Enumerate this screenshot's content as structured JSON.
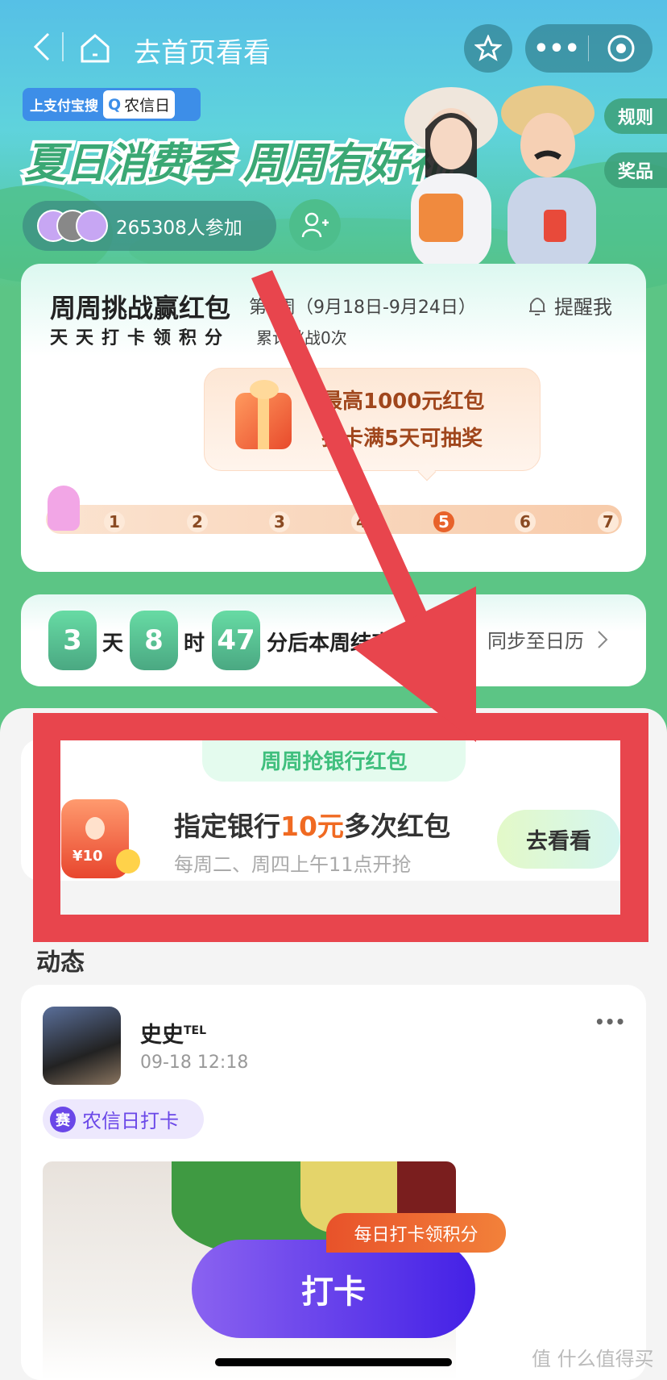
{
  "nav": {
    "title": "去首页看看",
    "back_icon": "chevron-left-icon",
    "home_icon": "home-icon",
    "star_icon": "star-icon",
    "more_icon": "more-dots-icon",
    "close_icon": "target-circle-icon"
  },
  "banner": {
    "search_prefix": "上支付宝搜",
    "search_keyword": "农信日",
    "headline": "夏日消费季 周周有好礼",
    "participants": "265308人参加",
    "rules_tab": "规则",
    "prizes_tab": "奖品"
  },
  "challenge": {
    "title": "周周挑战赢红包",
    "week": "第4周（9月18日-9月24日）",
    "remind": "提醒我",
    "subtitle": "天天打卡领积分",
    "count": "累计挑战0次",
    "bubble_line1": "最高1000元红包",
    "bubble_line2": "打卡满5天可抽奖",
    "days": [
      "1",
      "2",
      "3",
      "4",
      "5",
      "6",
      "7"
    ],
    "highlight_day": "5"
  },
  "countdown": {
    "days": "3",
    "days_unit": "天",
    "hours": "8",
    "hours_unit": "时",
    "minutes": "47",
    "suffix": "分后本周结束",
    "sync": "同步至日历"
  },
  "bank": {
    "header": "周周抢银行红包",
    "title_pre": "指定银行",
    "title_amount": "10元",
    "title_post": "多次红包",
    "subtitle": "每周二、周四上午11点开抢",
    "button": "去看看",
    "envelope_label": "¥10"
  },
  "feed": {
    "section_title": "动态",
    "post": {
      "user": "史史",
      "user_badge": "TEL",
      "time": "09-18 12:18",
      "tag_icon_text": "赛",
      "tag": "农信日打卡"
    }
  },
  "checkin": {
    "badge": "每日打卡领积分",
    "button": "打卡"
  },
  "watermark": "值 什么值得买",
  "colors": {
    "green": "#5cc585",
    "annotation_red": "#e8454d",
    "accent_orange": "#f06a22",
    "purple": "#5b3ce8"
  }
}
